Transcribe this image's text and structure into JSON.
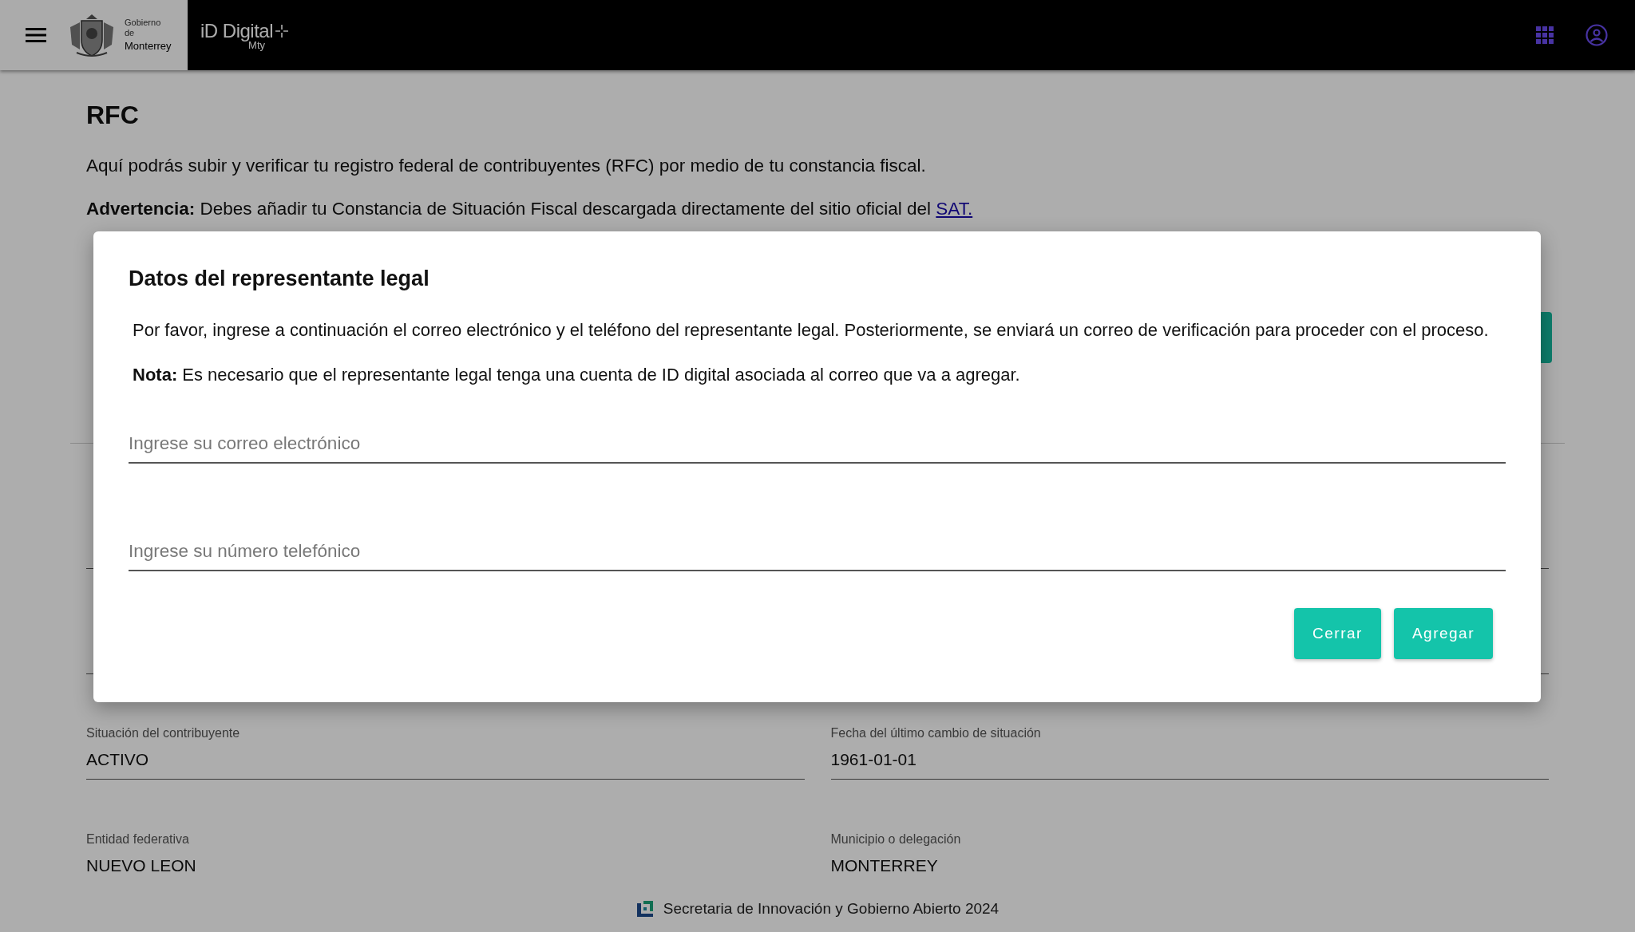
{
  "header": {
    "brand_lines": [
      "Gobierno",
      "de",
      "Monterrey"
    ],
    "app_name": "iD Digital",
    "app_sub": "Mty"
  },
  "page": {
    "title": "RFC",
    "intro": "Aquí podrás subir y verificar tu registro federal de contribuyentes (RFC) por medio de tu constancia fiscal.",
    "warning": "**Advertencia:** Debes añadir tu Constancia de Situación Fiscal descargada directamente del sitio oficial del",
    "warning_link": "SAT."
  },
  "details": {
    "rows": [
      {
        "cells": [
          {
            "label": "Situación del contribuyente",
            "value": "ACTIVO"
          },
          {
            "label": "Fecha del último cambio de situación",
            "value": "1961-01-01"
          }
        ]
      },
      {
        "cells": [
          {
            "label": "Entidad federativa",
            "value": "NUEVO LEON"
          },
          {
            "label": "Municipio o delegación",
            "value": "MONTERREY"
          }
        ]
      }
    ]
  },
  "dialog": {
    "title": "Datos del representante legal",
    "message": "Por favor, ingrese a continuación el correo electrónico y el teléfono del representante legal. Posteriormente, se enviará un correo de verificación para proceder con el proceso.",
    "note": "**Nota:** Es necesario que el representante legal tenga una cuenta de ID digital asociada al correo que va a agregar.",
    "fields": [
      {
        "placeholder": "Ingrese su correo electrónico"
      },
      {
        "placeholder": "Ingrese su número telefónico"
      }
    ],
    "buttons": [
      "Cerrar",
      "Agregar"
    ]
  },
  "footer": "Secretaria de Innovación y Gobierno Abierto 2024"
}
